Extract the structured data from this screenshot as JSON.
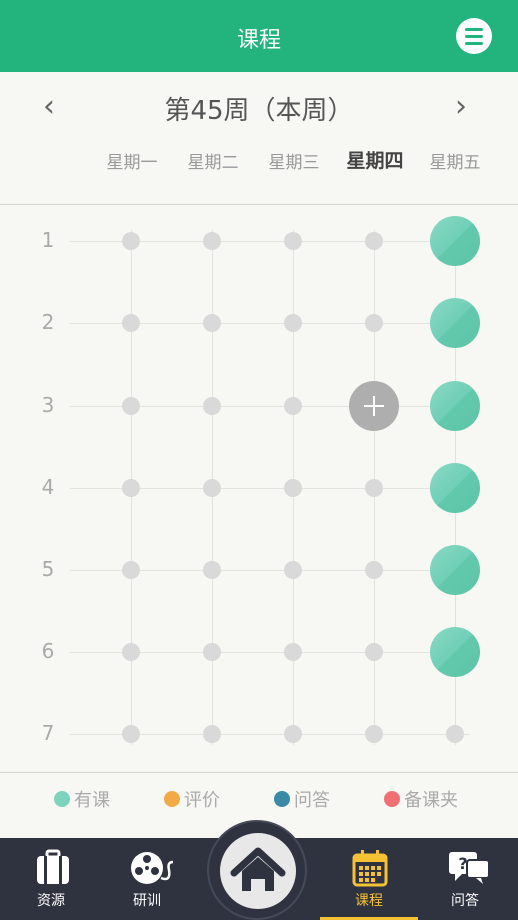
{
  "header": {
    "title": "课程",
    "menu_icon": "menu-icon"
  },
  "week": {
    "title": "第45周（本周）",
    "prev_label": "‹",
    "next_label": "›",
    "days": [
      "星期一",
      "星期二",
      "星期三",
      "星期四",
      "星期五"
    ],
    "today_index": 3
  },
  "schedule": {
    "periods": [
      "1",
      "2",
      "3",
      "4",
      "5",
      "6",
      "7"
    ],
    "course_slots": [
      [
        4,
        0
      ],
      [
        4,
        1
      ],
      [
        4,
        2
      ],
      [
        4,
        3
      ],
      [
        4,
        4
      ],
      [
        4,
        5
      ]
    ],
    "add_slot": [
      3,
      2
    ]
  },
  "legend": [
    {
      "label": "有课",
      "color": "#7dd3bc"
    },
    {
      "label": "评价",
      "color": "#f2aa45"
    },
    {
      "label": "问答",
      "color": "#3a8aa6"
    },
    {
      "label": "备课夹",
      "color": "#ef6f72"
    }
  ],
  "tabs": [
    {
      "label": "资源",
      "icon": "suitcase-icon"
    },
    {
      "label": "研训",
      "icon": "film-reel-icon"
    },
    {
      "label": "课程",
      "icon": "calendar-icon",
      "active": true
    },
    {
      "label": "问答",
      "icon": "question-chat-icon"
    }
  ],
  "home": {
    "icon": "home-icon"
  },
  "colors": {
    "primary": "#22b47c",
    "tabbar": "#2f3340",
    "active_tab": "#f5c236"
  }
}
